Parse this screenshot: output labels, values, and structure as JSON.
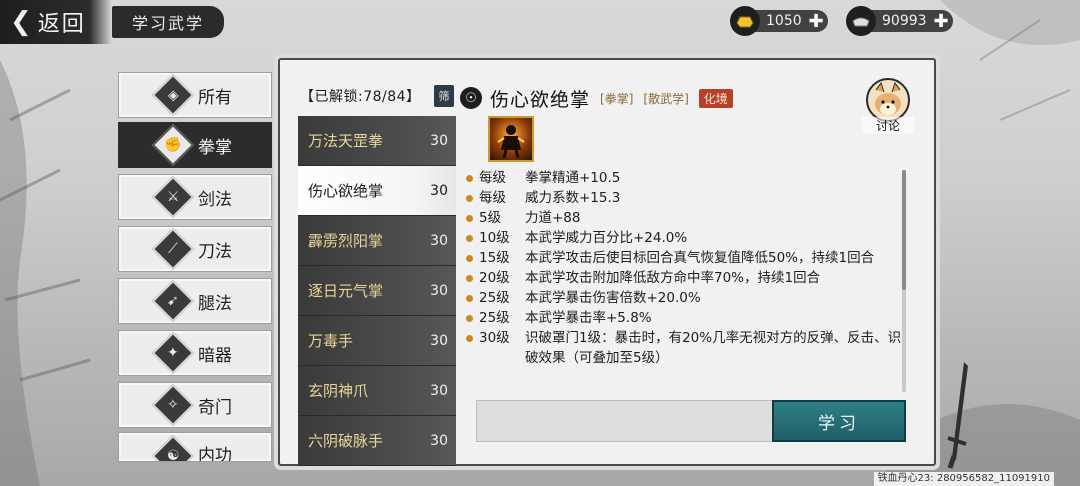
{
  "header": {
    "back_label": "返回",
    "title": "学习武学"
  },
  "currencies": [
    {
      "name": "gold",
      "value": "1050",
      "icon": "gold-ingot-icon"
    },
    {
      "name": "silver",
      "value": "90993",
      "icon": "silver-ingot-icon"
    }
  ],
  "categories": [
    {
      "label": "所有",
      "icon": "all-icon",
      "active": false
    },
    {
      "label": "拳掌",
      "icon": "fist-icon",
      "active": true
    },
    {
      "label": "剑法",
      "icon": "sword-icon",
      "active": false
    },
    {
      "label": "刀法",
      "icon": "blade-icon",
      "active": false
    },
    {
      "label": "腿法",
      "icon": "leg-icon",
      "active": false
    },
    {
      "label": "暗器",
      "icon": "shuriken-icon",
      "active": false
    },
    {
      "label": "奇门",
      "icon": "exotic-weapon-icon",
      "active": false
    },
    {
      "label": "内功",
      "icon": "inner-power-icon",
      "active": false
    }
  ],
  "skill_list": {
    "unlock_text": "【已解锁:78/84】",
    "filter_label": "筛",
    "items": [
      {
        "name": "万法天罡拳",
        "level": "30"
      },
      {
        "name": "伤心欲绝掌",
        "level": "30",
        "selected": true
      },
      {
        "name": "霹雳烈阳掌",
        "level": "30"
      },
      {
        "name": "逐日元气掌",
        "level": "30"
      },
      {
        "name": "万毒手",
        "level": "30"
      },
      {
        "name": "玄阴神爪",
        "level": "30"
      },
      {
        "name": "六阴破脉手",
        "level": "30"
      }
    ]
  },
  "detail": {
    "name": "伤心欲绝掌",
    "tag_type": "[拳掌]",
    "tag_school": "[散武学]",
    "tag_realm": "化境",
    "discuss_label": "讨论",
    "attributes": [
      {
        "level": "每级",
        "text": "拳掌精通+10.5"
      },
      {
        "level": "每级",
        "text": "威力系数+15.3"
      },
      {
        "level": "5级",
        "text": "力道+88"
      },
      {
        "level": "10级",
        "text": "本武学威力百分比+24.0%"
      },
      {
        "level": "15级",
        "text": "本武学攻击后使目标回合真气恢复值降低50%，持续1回合"
      },
      {
        "level": "20级",
        "text": "本武学攻击附加降低敌方命中率70%，持续1回合"
      },
      {
        "level": "25级",
        "text": "本武学暴击伤害倍数+20.0%"
      },
      {
        "level": "25级",
        "text": "本武学暴击率+5.8%"
      },
      {
        "level": "30级",
        "text": "识破罩门1级：暴击时，有20%几率无视对方的反弹、反击、识破效果（可叠加至5级）"
      }
    ],
    "learn_label": "学习"
  },
  "watermark": "铁血丹心23: 280956582_11091910",
  "colors": {
    "accent_teal": "#1f5f67",
    "realm_tag": "#b8402a",
    "list_gold_text": "#e8d59a",
    "dot": "#c98a1e"
  }
}
